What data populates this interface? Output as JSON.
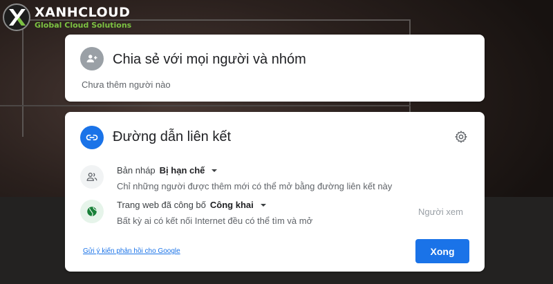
{
  "logo": {
    "name": "XANHCLOUD",
    "tagline": "Global Cloud Solutions"
  },
  "share_card": {
    "title": "Chia sẻ với mọi người và nhóm",
    "subtitle": "Chưa thêm người nào",
    "icon": "person-add-icon"
  },
  "link_card": {
    "title": "Đường dẫn liên kết",
    "icon": "link-icon",
    "settings_icon": "gear-icon",
    "draft": {
      "label": "Bản nháp",
      "value": "Bị hạn chế",
      "description": "Chỉ những người được thêm mới có thể mở bằng đường liên kết này",
      "icon": "people-icon"
    },
    "published": {
      "label": "Trang web đã công bố",
      "value": "Công khai",
      "description": "Bất kỳ ai có kết nối Internet đều có thể tìm và mở",
      "icon": "globe-icon"
    },
    "role": "Người xem",
    "feedback_link": "Gửi ý kiến phản hồi cho Google",
    "done_button": "Xong"
  },
  "colors": {
    "accent": "#1a73e8",
    "brand_green": "#7cc242",
    "globe_green": "#188038"
  }
}
